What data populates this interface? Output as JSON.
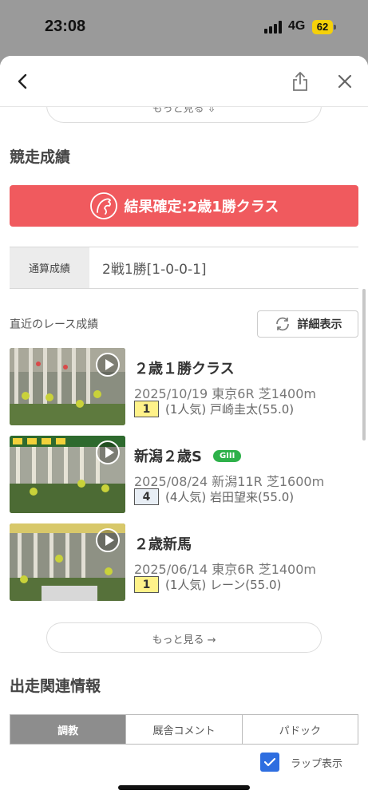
{
  "status": {
    "time": "23:08",
    "network": "4G",
    "battery": "62"
  },
  "more_top": "もっと見る ⇩",
  "section_results": "競走成績",
  "result_banner": "結果確定:2歳1勝クラス",
  "tsusan": {
    "label": "通算成績",
    "value": "2戦1勝[1-0-0-1]"
  },
  "recent_label": "直近のレース成績",
  "detail_button": "詳細表示",
  "races": [
    {
      "name": "２歳１勝クラス",
      "grade": "",
      "info": "2025/10/19 東京6R 芝1400m",
      "position": "1",
      "result": "(1人気) 戸崎圭太(55.0)"
    },
    {
      "name": "新潟２歳S",
      "grade": "GIII",
      "info": "2025/08/24 新潟11R 芝1600m",
      "position": "4",
      "result": "(4人気) 岩田望来(55.0)"
    },
    {
      "name": "２歳新馬",
      "grade": "",
      "info": "2025/06/14 東京6R 芝1400m",
      "position": "1",
      "result": "(1人気) レーン(55.0)"
    }
  ],
  "more_bottom": "もっと見る →",
  "section_related": "出走関連情報",
  "tabs": [
    "調教",
    "厩舎コメント",
    "パドック"
  ],
  "lap_label": "ラップ表示",
  "colors": {
    "banner": "#f05a5e",
    "grade": "#2eb14a",
    "gold": "#fff28a",
    "checkbox": "#2e6ee0"
  },
  "icons": [
    "back-chevron-icon",
    "share-icon",
    "close-icon",
    "horse-logo-icon",
    "refresh-icon",
    "play-icon",
    "checkmark-icon"
  ]
}
